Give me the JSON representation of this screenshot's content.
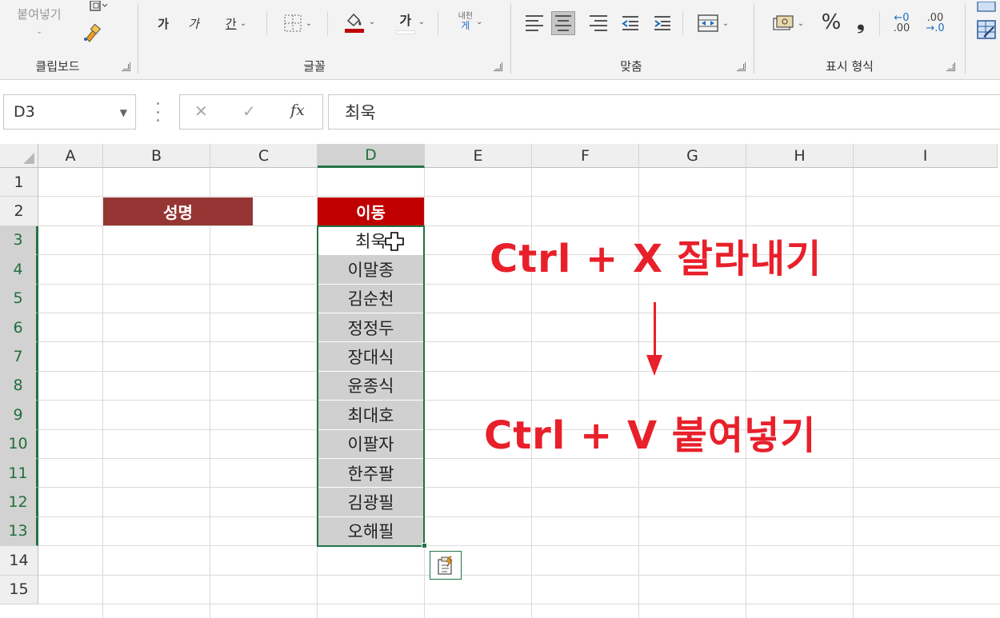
{
  "ribbon": {
    "clipboard": {
      "paste_label": "붙여넣기",
      "group_label": "클립보드"
    },
    "font": {
      "bold_label": "가",
      "italic_label": "가",
      "underline_label": "간",
      "font_color_label": "가",
      "wrap_label_top": "내천",
      "wrap_label_bottom": "게",
      "group_label": "글꼴"
    },
    "alignment": {
      "group_label": "맞춤"
    },
    "number": {
      "percent_label": "%",
      "comma_label": "❟",
      "inc_decimal_top": "←0",
      "inc_decimal_bottom": ".00",
      "dec_decimal_top": ".00",
      "dec_decimal_bottom": "→.0",
      "group_label": "표시 형식"
    }
  },
  "formula_bar": {
    "name_box": "D3",
    "fx_label": "fx",
    "cancel_label": "✕",
    "enter_label": "✓",
    "formula_value": "최욱"
  },
  "grid": {
    "columns": [
      "A",
      "B",
      "C",
      "D",
      "E",
      "F",
      "G",
      "H",
      "I"
    ],
    "active_column": "D",
    "rows": [
      "1",
      "2",
      "3",
      "4",
      "5",
      "6",
      "7",
      "8",
      "9",
      "10",
      "11",
      "12",
      "13",
      "14",
      "15"
    ],
    "active_rows_range": [
      "3",
      "13"
    ],
    "b2_header": "성명",
    "d2_header": "이동",
    "d3": "최욱",
    "d_values": [
      "이말종",
      "김순천",
      "정정두",
      "장대식",
      "윤종식",
      "최대호",
      "이팔자",
      "한주팔",
      "김광필",
      "오해필"
    ],
    "b2_color": "#963634",
    "d2_color": "#c00000"
  },
  "annotations": {
    "cut": "Ctrl + X 잘라내기",
    "paste": "Ctrl + V 붙여넣기",
    "color": "#e8202a"
  },
  "icons": {
    "format_painter": "format-painter-icon",
    "borders": "borders-icon",
    "fill_color": "fill-color-icon",
    "merge_center": "merge-center-icon",
    "currency": "currency-icon",
    "paste_options": "paste-options-icon",
    "move_cursor": "move-cursor-icon"
  }
}
